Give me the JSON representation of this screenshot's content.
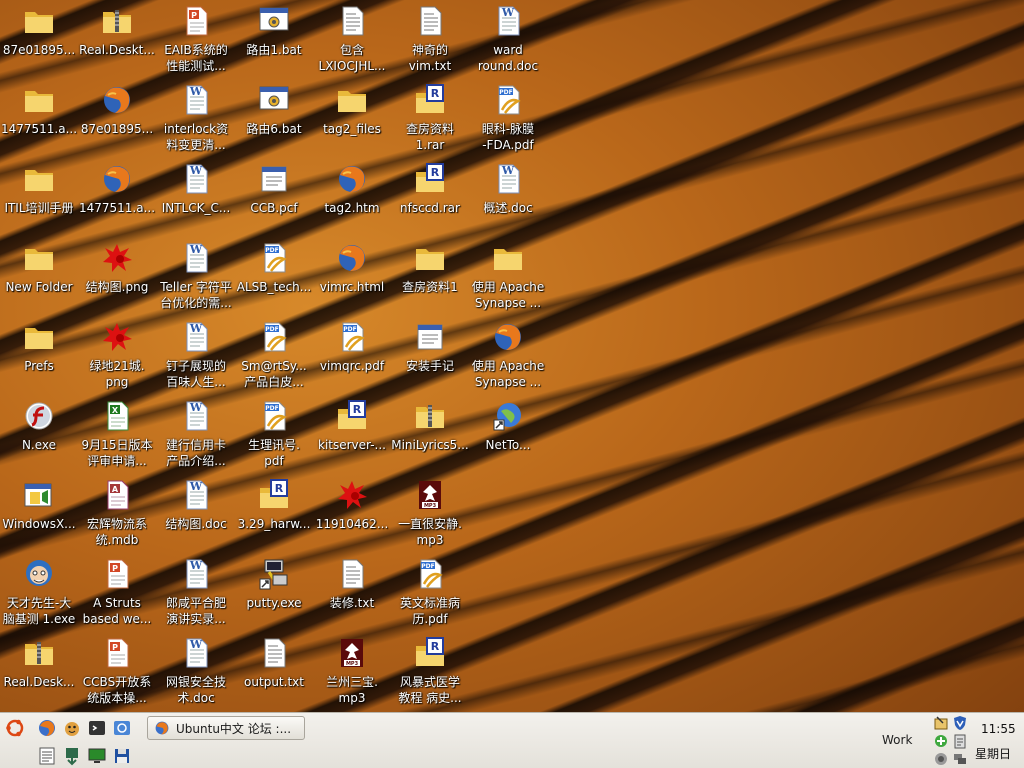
{
  "desktop": {
    "icons": [
      {
        "label": "87e01895...",
        "icon": "folder-icon"
      },
      {
        "label": "Real.Deskt...",
        "icon": "zip-icon"
      },
      {
        "label": "EAIB系统的\n性能测试...",
        "icon": "powerpoint-icon"
      },
      {
        "label": "路由1.bat",
        "icon": "batch-icon"
      },
      {
        "label": "包含\nLXIOCJHL...",
        "icon": "text-file-icon"
      },
      {
        "label": "神奇的\nvim.txt",
        "icon": "text-file-icon"
      },
      {
        "label": "ward\nround.doc",
        "icon": "word-doc-icon"
      },
      {
        "label": "1477511.a...",
        "icon": "folder-icon"
      },
      {
        "label": "87e01895...",
        "icon": "firefox-icon"
      },
      {
        "label": "interlock资\n料变更清...",
        "icon": "word-doc-icon"
      },
      {
        "label": "路由6.bat",
        "icon": "batch-icon"
      },
      {
        "label": "tag2_files",
        "icon": "folder-icon"
      },
      {
        "label": "查房资料\n1.rar",
        "icon": "rar-icon"
      },
      {
        "label": "眼科-脉膜\n-FDA.pdf",
        "icon": "pdf-icon"
      },
      {
        "label": "ITIL培训手册",
        "icon": "folder-icon"
      },
      {
        "label": "1477511.a...",
        "icon": "firefox-icon"
      },
      {
        "label": "INTLCK_C...",
        "icon": "word-doc-icon"
      },
      {
        "label": "CCB.pcf",
        "icon": "config-file-icon"
      },
      {
        "label": "tag2.htm",
        "icon": "firefox-icon"
      },
      {
        "label": "nfsccd.rar",
        "icon": "rar-icon"
      },
      {
        "label": "概述.doc",
        "icon": "word-doc-icon"
      },
      {
        "label": "New Folder",
        "icon": "folder-icon"
      },
      {
        "label": "结构图.png",
        "icon": "image-splat-icon"
      },
      {
        "label": "Teller 字符平\n台优化的需...",
        "icon": "word-doc-icon"
      },
      {
        "label": "ALSB_tech...",
        "icon": "pdf-icon"
      },
      {
        "label": "vimrc.html",
        "icon": "firefox-icon"
      },
      {
        "label": "查房资料1",
        "icon": "folder-icon"
      },
      {
        "label": "使用 Apache\nSynapse ...",
        "icon": "folder-icon"
      },
      {
        "label": "Prefs",
        "icon": "folder-icon"
      },
      {
        "label": "绿地21城.\npng",
        "icon": "image-splat-icon"
      },
      {
        "label": "钉子展现的\n百味人生...",
        "icon": "word-doc-icon"
      },
      {
        "label": "Sm@rtSy...\n产品白皮...",
        "icon": "pdf-icon"
      },
      {
        "label": "vimqrc.pdf",
        "icon": "pdf-icon"
      },
      {
        "label": "安装手记",
        "icon": "config-file-icon"
      },
      {
        "label": "使用 Apache\nSynapse ...",
        "icon": "firefox-icon"
      },
      {
        "label": "N.exe",
        "icon": "flash-icon"
      },
      {
        "label": "9月15日版本\n评审申请...",
        "icon": "excel-icon"
      },
      {
        "label": "建行信用卡\n产品介绍...",
        "icon": "word-doc-icon"
      },
      {
        "label": "生理讯号.\npdf",
        "icon": "pdf-icon"
      },
      {
        "label": "kitserver-...",
        "icon": "rar-icon"
      },
      {
        "label": "MiniLyrics5...",
        "icon": "zip-icon"
      },
      {
        "label": "NetTo...",
        "icon": "globe-shortcut-icon"
      },
      {
        "label": "WindowsX...",
        "icon": "installer-icon"
      },
      {
        "label": "宏辉物流系\n统.mdb",
        "icon": "access-db-icon"
      },
      {
        "label": "结构图.doc",
        "icon": "word-doc-icon"
      },
      {
        "label": "3.29_harw...",
        "icon": "rar-icon"
      },
      {
        "label": "11910462...",
        "icon": "image-splat-icon"
      },
      {
        "label": "一直很安静.\nmp3",
        "icon": "mp3-icon"
      },
      {
        "label": "天才先生-大\n脑基测 1.exe",
        "icon": "character-exe-icon"
      },
      {
        "label": "A Struts\nbased we...",
        "icon": "powerpoint-icon"
      },
      {
        "label": "郎咸平合肥\n演讲实录...",
        "icon": "word-doc-icon"
      },
      {
        "label": "putty.exe",
        "icon": "putty-shortcut-icon"
      },
      {
        "label": "装修.txt",
        "icon": "text-file-icon"
      },
      {
        "label": "英文标准病\n历.pdf",
        "icon": "pdf-icon"
      },
      {
        "label": "Real.Desk...",
        "icon": "zip-icon"
      },
      {
        "label": "CCBS开放系\n统版本操...",
        "icon": "powerpoint-icon"
      },
      {
        "label": "网银安全技\n术.doc",
        "icon": "word-doc-icon"
      },
      {
        "label": "output.txt",
        "icon": "text-file-icon"
      },
      {
        "label": "兰州三宝.\nmp3",
        "icon": "mp3-icon"
      },
      {
        "label": "风暴式医学\n教程 病史...",
        "icon": "rar-icon"
      }
    ]
  },
  "panel": {
    "launchers": [
      {
        "name": "ubuntu-menu-icon"
      },
      {
        "name": "firefox-launcher-icon"
      },
      {
        "name": "pidgin-launcher-icon"
      },
      {
        "name": "terminal-launcher-icon"
      },
      {
        "name": "browser-launcher-icon"
      },
      {
        "name": "text-editor-launcher-icon"
      },
      {
        "name": "download-launcher-icon"
      },
      {
        "name": "monitor-launcher-icon"
      },
      {
        "name": "save-launcher-icon"
      }
    ],
    "task_title": "Ubuntu中文 论坛 :...",
    "workspace": "Work",
    "time": "11:55",
    "day": "星期日"
  },
  "colors": {
    "folder": "#f3d36a",
    "word": "#2f5aa8",
    "pdf": "#c93a2b",
    "rar": "#233c9c",
    "panel": "#ebe8e2"
  }
}
